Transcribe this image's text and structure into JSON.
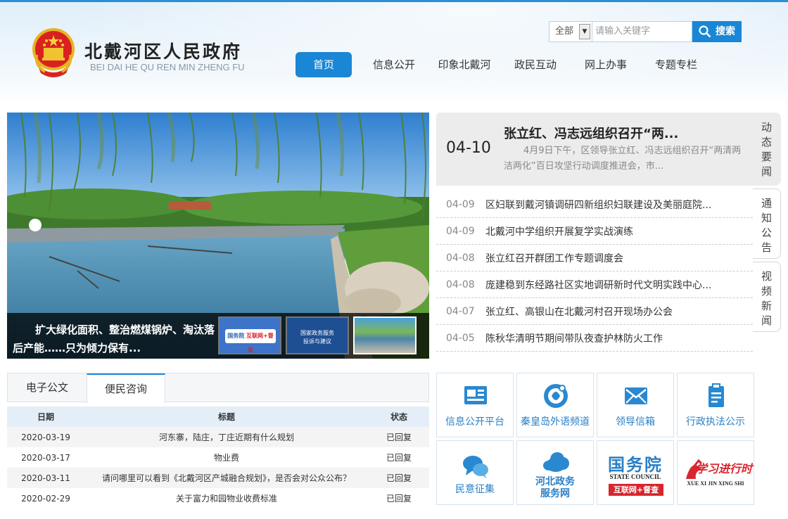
{
  "header": {
    "site_name": "北戴河区人民政府",
    "site_pinyin": "BEI DAI HE QU REN MIN ZHENG FU"
  },
  "search": {
    "scope": "全部",
    "placeholder": "请输入关键字",
    "button_label": "搜索"
  },
  "nav": {
    "items": [
      "首页",
      "信息公开",
      "印象北戴河",
      "政民互动",
      "网上办事",
      "专题专栏"
    ],
    "active_index": 0
  },
  "slider": {
    "caption": "扩大绿化面积、整治燃煤锅炉、淘汰落后产能……只为倾力保有...",
    "thumb1_title": "国务院",
    "thumb1_badge": "互联网+督查",
    "thumb2_line1": "国家政务服务",
    "thumb2_line2": "投诉与建议"
  },
  "news": {
    "headline": {
      "date": "04-10",
      "title": "张立红、冯志远组织召开“两...",
      "summary": "4月9日下午，区领导张立红、冯志远组织召开“两清两洁两化”百日攻坚行动调度推进会，市..."
    },
    "items": [
      {
        "date": "04-09",
        "title": "区妇联到戴河镇调研四新组织妇联建设及美丽庭院..."
      },
      {
        "date": "04-09",
        "title": "北戴河中学组织开展复学实战演练"
      },
      {
        "date": "04-08",
        "title": "张立红召开群团工作专题调度会"
      },
      {
        "date": "04-08",
        "title": "庞建稳到东经路社区实地调研新时代文明实践中心..."
      },
      {
        "date": "04-07",
        "title": "张立红、高银山在北戴河村召开现场办公会"
      },
      {
        "date": "04-05",
        "title": "陈秋华清明节期间带队夜查护林防火工作"
      }
    ],
    "tabs": [
      "动态要闻",
      "通知公告",
      "视频新闻"
    ]
  },
  "consult": {
    "tabs": [
      "电子公文",
      "便民咨询"
    ],
    "active_tab": 1,
    "headers": [
      "日期",
      "标题",
      "状态"
    ],
    "rows": [
      [
        "2020-03-19",
        "河东寨，陆庄，丁庄近期有什么规划",
        "已回复"
      ],
      [
        "2020-03-17",
        "物业费",
        "已回复"
      ],
      [
        "2020-03-11",
        "请问哪里可以看到《北戴河区产城融合规划》，是否会对公众公布？",
        "已回复"
      ],
      [
        "2020-02-29",
        "关于富力和园物业收费标准",
        "已回复"
      ]
    ]
  },
  "services": {
    "row1": [
      "信息公开平台",
      "秦皇岛外语频道",
      "领导信箱",
      "行政执法公示"
    ],
    "minyi": "民意征集",
    "hebei_line1": "河北政务",
    "hebei_line2": "服务网",
    "guowuyuan_title": "国务院",
    "guowuyuan_en": "STATE COUNCIL",
    "guowuyuan_badge": "互联网+督查",
    "xuexi_title": "学习进行时",
    "xuexi_pinyin": "XUE XI JIN XING SHI"
  },
  "colors": {
    "accent": "#1a86d6",
    "service_text": "#2a7fc6",
    "badge_red": "#d7262e"
  },
  "icons": [
    "search-icon",
    "national-emblem-icon",
    "info-platform-icon",
    "foreign-channel-icon",
    "mail-icon",
    "clipboard-icon",
    "chat-icon",
    "cloud-icon"
  ]
}
